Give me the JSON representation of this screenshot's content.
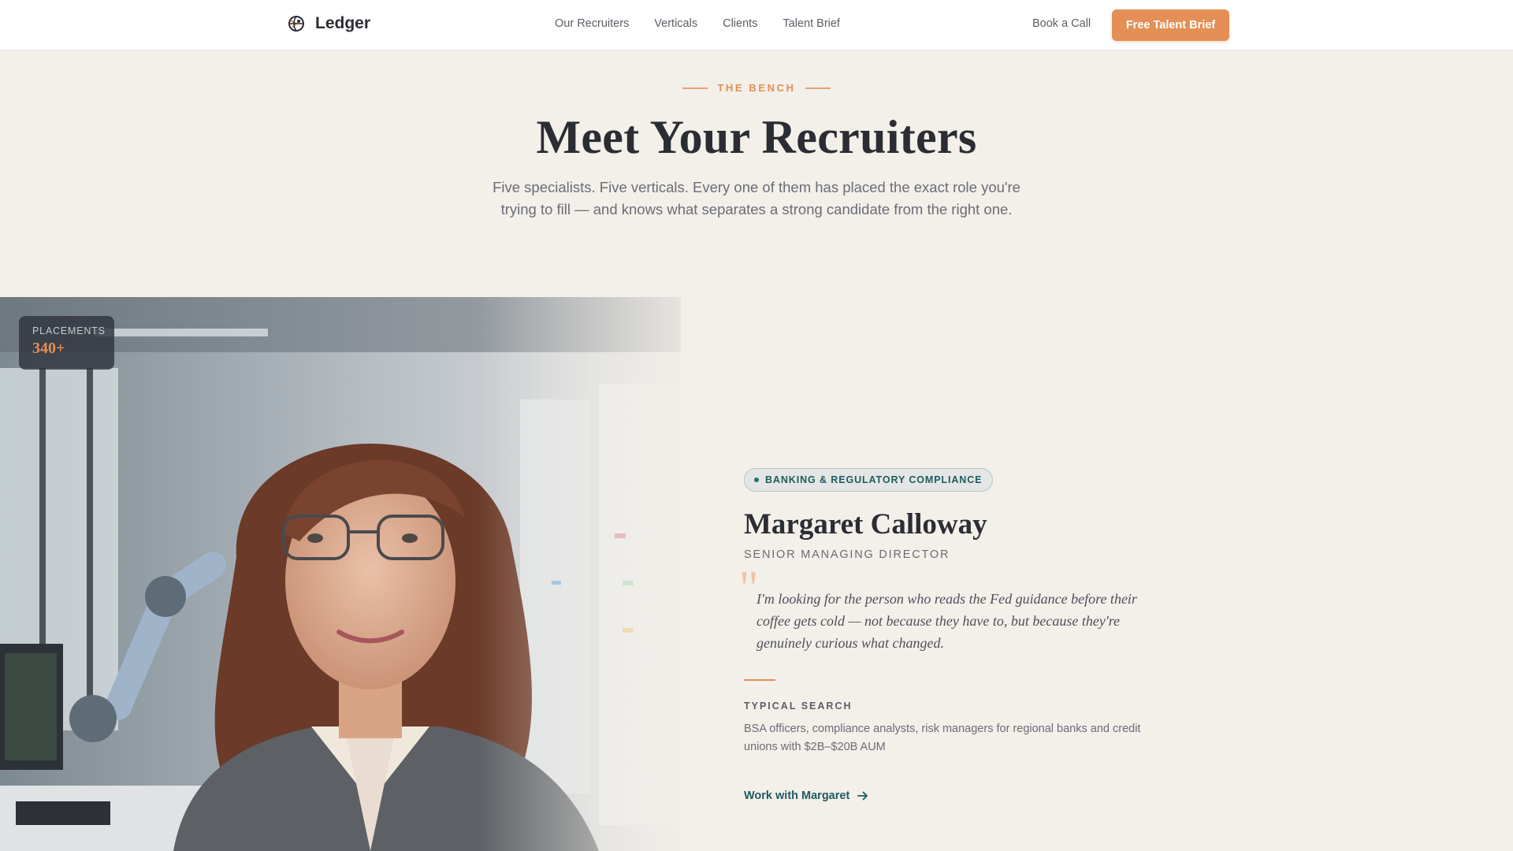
{
  "header": {
    "brand": "Ledger",
    "brand_icon": "globe-logo-icon",
    "nav": [
      "Our Recruiters",
      "Verticals",
      "Clients",
      "Talent Brief"
    ],
    "book_call": "Book a Call",
    "cta": "Free Talent Brief"
  },
  "hero": {
    "eyebrow": "THE BENCH",
    "title": "Meet Your Recruiters",
    "subtitle": "Five specialists. Five verticals. Every one of them has placed the exact role you're trying to fill — and knows what separates a strong candidate from the right one."
  },
  "profile": {
    "stat_label": "PLACEMENTS",
    "stat_value": "340+",
    "vertical": "BANKING & REGULATORY COMPLIANCE",
    "name": "Margaret Calloway",
    "title": "SENIOR MANAGING DIRECTOR",
    "quote": "I'm looking for the person who reads the Fed guidance before their coffee gets cold — not because they have to, but because they're genuinely curious what changed.",
    "search_label": "TYPICAL SEARCH",
    "search_text": "BSA officers, compliance analysts, risk managers for regional banks and credit unions with $2B–$20B AUM",
    "link": "Work with Margaret",
    "link_icon": "arrow-right-icon"
  },
  "colors": {
    "accent": "#e38f55",
    "teal": "#1f5a62",
    "background": "#f3efe9"
  }
}
